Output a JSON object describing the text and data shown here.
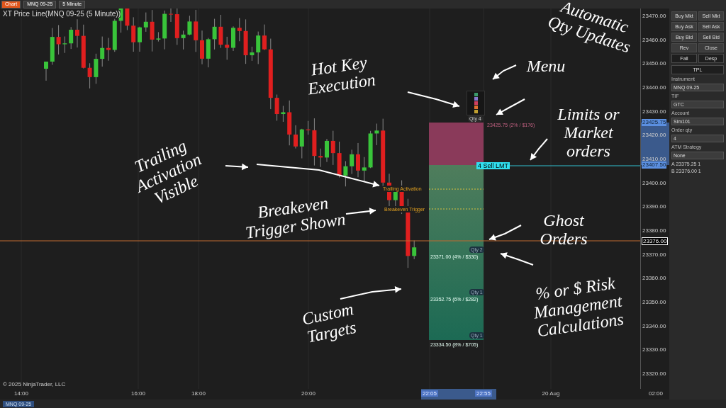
{
  "toolbar": {
    "chart_button": "Chart",
    "instrument": "MNQ 09-25",
    "interval": "5 Minute"
  },
  "chart": {
    "title": "XT Price Line(MNQ 09-25 (5 Minute))",
    "copyright": "© 2025 NinjaTrader, LLC",
    "price_labels": [
      "23470.00",
      "23460.00",
      "23450.00",
      "23440.00",
      "23430.00",
      "23420.00",
      "23410.00",
      "23400.00",
      "23390.00",
      "23380.00",
      "23370.00",
      "23360.00",
      "23350.00",
      "23340.00",
      "23330.00",
      "23320.00"
    ],
    "order_price_labels": [
      "23425.75",
      "23407.50"
    ],
    "current_price": "23376.00",
    "time_labels": [
      {
        "text": "14:00",
        "highlighted": false
      },
      {
        "text": "16:00",
        "highlighted": false
      },
      {
        "text": "18:00",
        "highlighted": false
      },
      {
        "text": "20:00",
        "highlighted": false
      },
      {
        "text": "22:05",
        "highlighted": true
      },
      {
        "text": "22:55",
        "highlighted": true
      },
      {
        "text": "20 Aug",
        "highlighted": false
      },
      {
        "text": "02:00",
        "highlighted": false
      }
    ]
  },
  "order": {
    "qty_tag": "Qty 4",
    "stop_text": "23425.75 (2% / $176)",
    "label": "4 Sell LMT",
    "markers": [
      "Trailing Activation",
      "Breakeven Trigger"
    ],
    "targets": [
      {
        "qty": "Qty 2",
        "text": "23371.00 (4% / $330)"
      },
      {
        "qty": "Qty 1",
        "text": "23352.75 (6% / $282)"
      },
      {
        "qty": "Qty 1",
        "text": "23334.50 (8% / $705)"
      }
    ]
  },
  "annotations": [
    "Hot Key Execution",
    "Menu",
    "Automatic Qty Updates",
    "Limits or Market orders",
    "Trailing Activation Visible",
    "Breakeven Trigger Shown",
    "Ghost Orders",
    "% or $ Risk Management Calculations",
    "Custom Targets"
  ],
  "side_panel": {
    "buttons": [
      "Buy Mkt",
      "Sell Mkt",
      "Buy Ask",
      "Sell Ask",
      "Buy Bid",
      "Sell Bid",
      "Rev",
      "Close",
      "Fall",
      "Desp"
    ],
    "wide_button": "TPL",
    "fields": [
      {
        "label": "Instrument",
        "value": "MNQ 09-25"
      },
      {
        "label": "TIF",
        "value": "GTC"
      },
      {
        "label": "Account",
        "value": "Sim101"
      },
      {
        "label": "Order qty",
        "value": "4"
      }
    ],
    "atm_label": "ATM Strategy",
    "atm_value": "None",
    "positions": [
      {
        "side": "A",
        "price": "23375.25",
        "qty": "1"
      },
      {
        "side": "B",
        "price": "23376.00",
        "qty": "1"
      }
    ]
  },
  "bottom_tab": "MNQ 09-25"
}
